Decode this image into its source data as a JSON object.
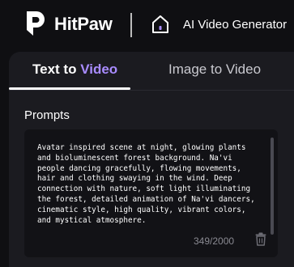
{
  "header": {
    "brand": "HitPaw",
    "title": "AI Video Generator",
    "icons": [
      "hitpaw-logo-icon",
      "home-icon"
    ]
  },
  "tabs": [
    {
      "prefix": "Text to ",
      "accent": "Video",
      "active": true
    },
    {
      "label": "Image to Video",
      "active": false
    }
  ],
  "prompt": {
    "label": "Prompts",
    "text": "Avatar inspired scene at night, glowing plants and bioluminescent forest background. Na'vi people dancing gracefully, flowing movements, hair and clothing swaying in the wind. Deep connection with nature, soft light illuminating the forest, detailed animation of Na'vi dancers, cinematic style, high quality, vibrant colors, and mystical atmosphere.",
    "char_count": "349/2000",
    "delete_icon": "trash-icon"
  },
  "colors": {
    "background": "#0f0f12",
    "panel": "#1b1b20",
    "accent": "#a98cff",
    "muted_text": "#8a8a92"
  }
}
